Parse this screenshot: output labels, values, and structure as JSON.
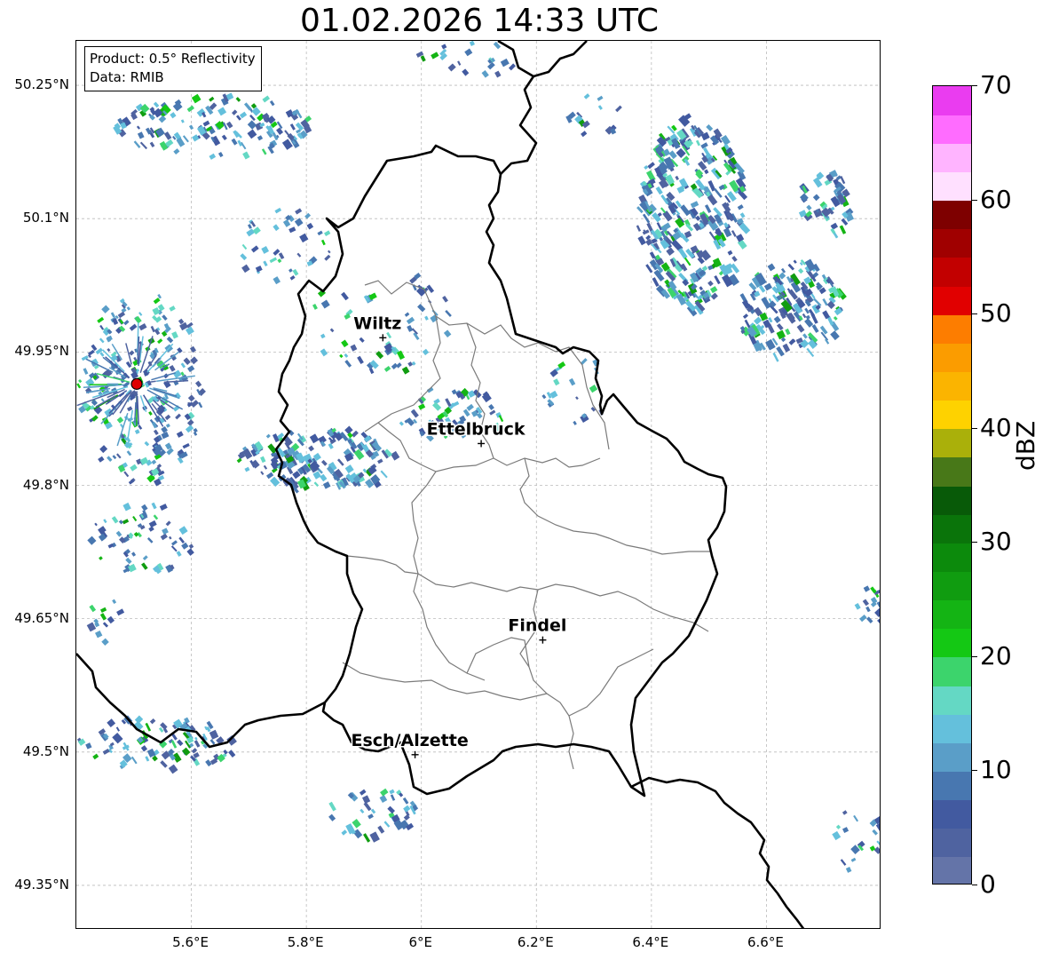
{
  "title": "01.02.2026 14:33 UTC",
  "info": {
    "product": "Product: 0.5° Reflectivity",
    "data_source": "Data: RMIB"
  },
  "map": {
    "lat_range": [
      49.3,
      50.3
    ],
    "lon_range": [
      5.4,
      6.8
    ],
    "lat_ticks": [
      {
        "value": 50.25,
        "label": "50.25°N"
      },
      {
        "value": 50.1,
        "label": "50.1°N"
      },
      {
        "value": 49.95,
        "label": "49.95°N"
      },
      {
        "value": 49.8,
        "label": "49.8°N"
      },
      {
        "value": 49.65,
        "label": "49.65°N"
      },
      {
        "value": 49.5,
        "label": "49.5°N"
      },
      {
        "value": 49.35,
        "label": "49.35°N"
      }
    ],
    "lon_ticks": [
      {
        "value": 5.6,
        "label": "5.6°E"
      },
      {
        "value": 5.8,
        "label": "5.8°E"
      },
      {
        "value": 6.0,
        "label": "6°E"
      },
      {
        "value": 6.2,
        "label": "6.2°E"
      },
      {
        "value": 6.4,
        "label": "6.4°E"
      },
      {
        "value": 6.6,
        "label": "6.6°E"
      }
    ],
    "grid": true,
    "radar_site": {
      "lat": 49.914,
      "lon": 5.505
    },
    "cities": [
      {
        "name": "Wiltz",
        "lat": 49.966,
        "lon": 5.933
      },
      {
        "name": "Ettelbruck",
        "lat": 49.847,
        "lon": 6.104
      },
      {
        "name": "Findel",
        "lat": 49.626,
        "lon": 6.211
      },
      {
        "name": "Esch/Alzette",
        "lat": 49.497,
        "lon": 5.989
      }
    ],
    "colors": {
      "border": "#000000",
      "cantons": "#7a7a7a",
      "grid": "#bbbbbb",
      "radar_site": "#e00000"
    }
  },
  "colorbar": {
    "unit": "dBZ",
    "min": 0,
    "max": 70,
    "ticks": [
      0,
      10,
      20,
      30,
      40,
      50,
      60,
      70
    ],
    "colors": [
      "#6474a8",
      "#4f63a0",
      "#425aa0",
      "#4877b0",
      "#5a9ec8",
      "#64c0dc",
      "#64d8c4",
      "#3cd46c",
      "#14c814",
      "#14b414",
      "#109c10",
      "#0c8a0c",
      "#0a740a",
      "#085a08",
      "#487818",
      "#aab00a",
      "#fed200",
      "#fbb400",
      "#fb9c00",
      "#fd7d00",
      "#e10000",
      "#c20000",
      "#a00000",
      "#7e0000",
      "#ffe0ff",
      "#ffb4ff",
      "#ff6cff",
      "#ea3cf0"
    ]
  }
}
